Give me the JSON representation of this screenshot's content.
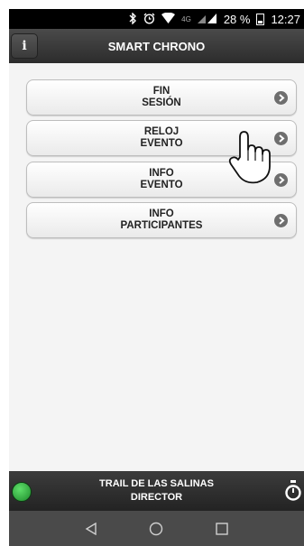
{
  "status_bar": {
    "network": "4G",
    "battery": "28 %",
    "time": "12:27",
    "icons": [
      "bluetooth-icon",
      "alarm-icon",
      "wifi-icon",
      "signal-icon",
      "battery-icon"
    ]
  },
  "header": {
    "title": "SMART CHRONO",
    "info_label": "i"
  },
  "menu": {
    "items": [
      {
        "line1": "FIN",
        "line2": "SESIÓN"
      },
      {
        "line1": "RELOJ",
        "line2": "EVENTO"
      },
      {
        "line1": "INFO",
        "line2": "EVENTO"
      },
      {
        "line1": "INFO",
        "line2": "PARTICIPANTES"
      }
    ]
  },
  "footer": {
    "event": "TRAIL DE LAS SALINAS",
    "role": "DIRECTOR",
    "status_color": "#2fbf3f"
  },
  "navbar": {
    "icons": [
      "back-icon",
      "home-icon",
      "recents-icon"
    ]
  },
  "colors": {
    "header_bg": "#333333",
    "content_bg": "#f4f4f4",
    "chevron": "#6e6e6e"
  }
}
